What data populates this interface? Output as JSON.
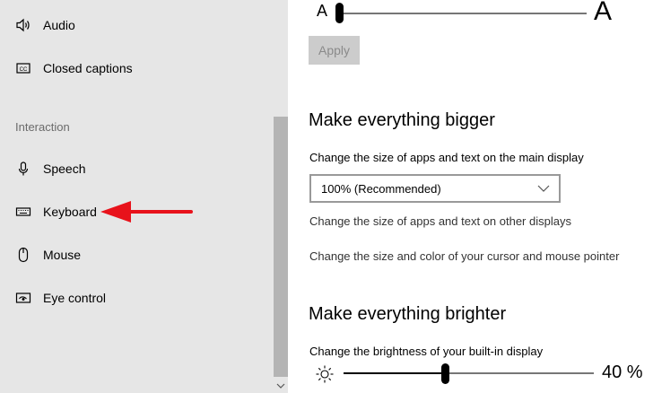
{
  "sidebar": {
    "items_top": [
      {
        "label": "Audio",
        "icon": "speaker-icon"
      },
      {
        "label": "Closed captions",
        "icon": "closed-captions-icon"
      }
    ],
    "section_header": "Interaction",
    "items_interaction": [
      {
        "label": "Speech",
        "icon": "microphone-icon"
      },
      {
        "label": "Keyboard",
        "icon": "keyboard-icon"
      },
      {
        "label": "Mouse",
        "icon": "mouse-icon"
      },
      {
        "label": "Eye control",
        "icon": "eye-control-icon"
      }
    ]
  },
  "text_size": {
    "small_label": "A",
    "large_label": "A",
    "apply_label": "Apply"
  },
  "bigger": {
    "heading": "Make everything bigger",
    "description": "Change the size of apps and text on the main display",
    "scale_value": "100% (Recommended)",
    "link_other_displays": "Change the size of apps and text on other displays",
    "link_cursor": "Change the size and color of your cursor and mouse pointer"
  },
  "brighter": {
    "heading": "Make everything brighter",
    "description": "Change the brightness of your built-in display",
    "brightness_value": "40 %",
    "brightness_level": 0.4
  },
  "colors": {
    "sidebar_bg": "#e6e6e6",
    "annotation_arrow": "#e8121b"
  }
}
